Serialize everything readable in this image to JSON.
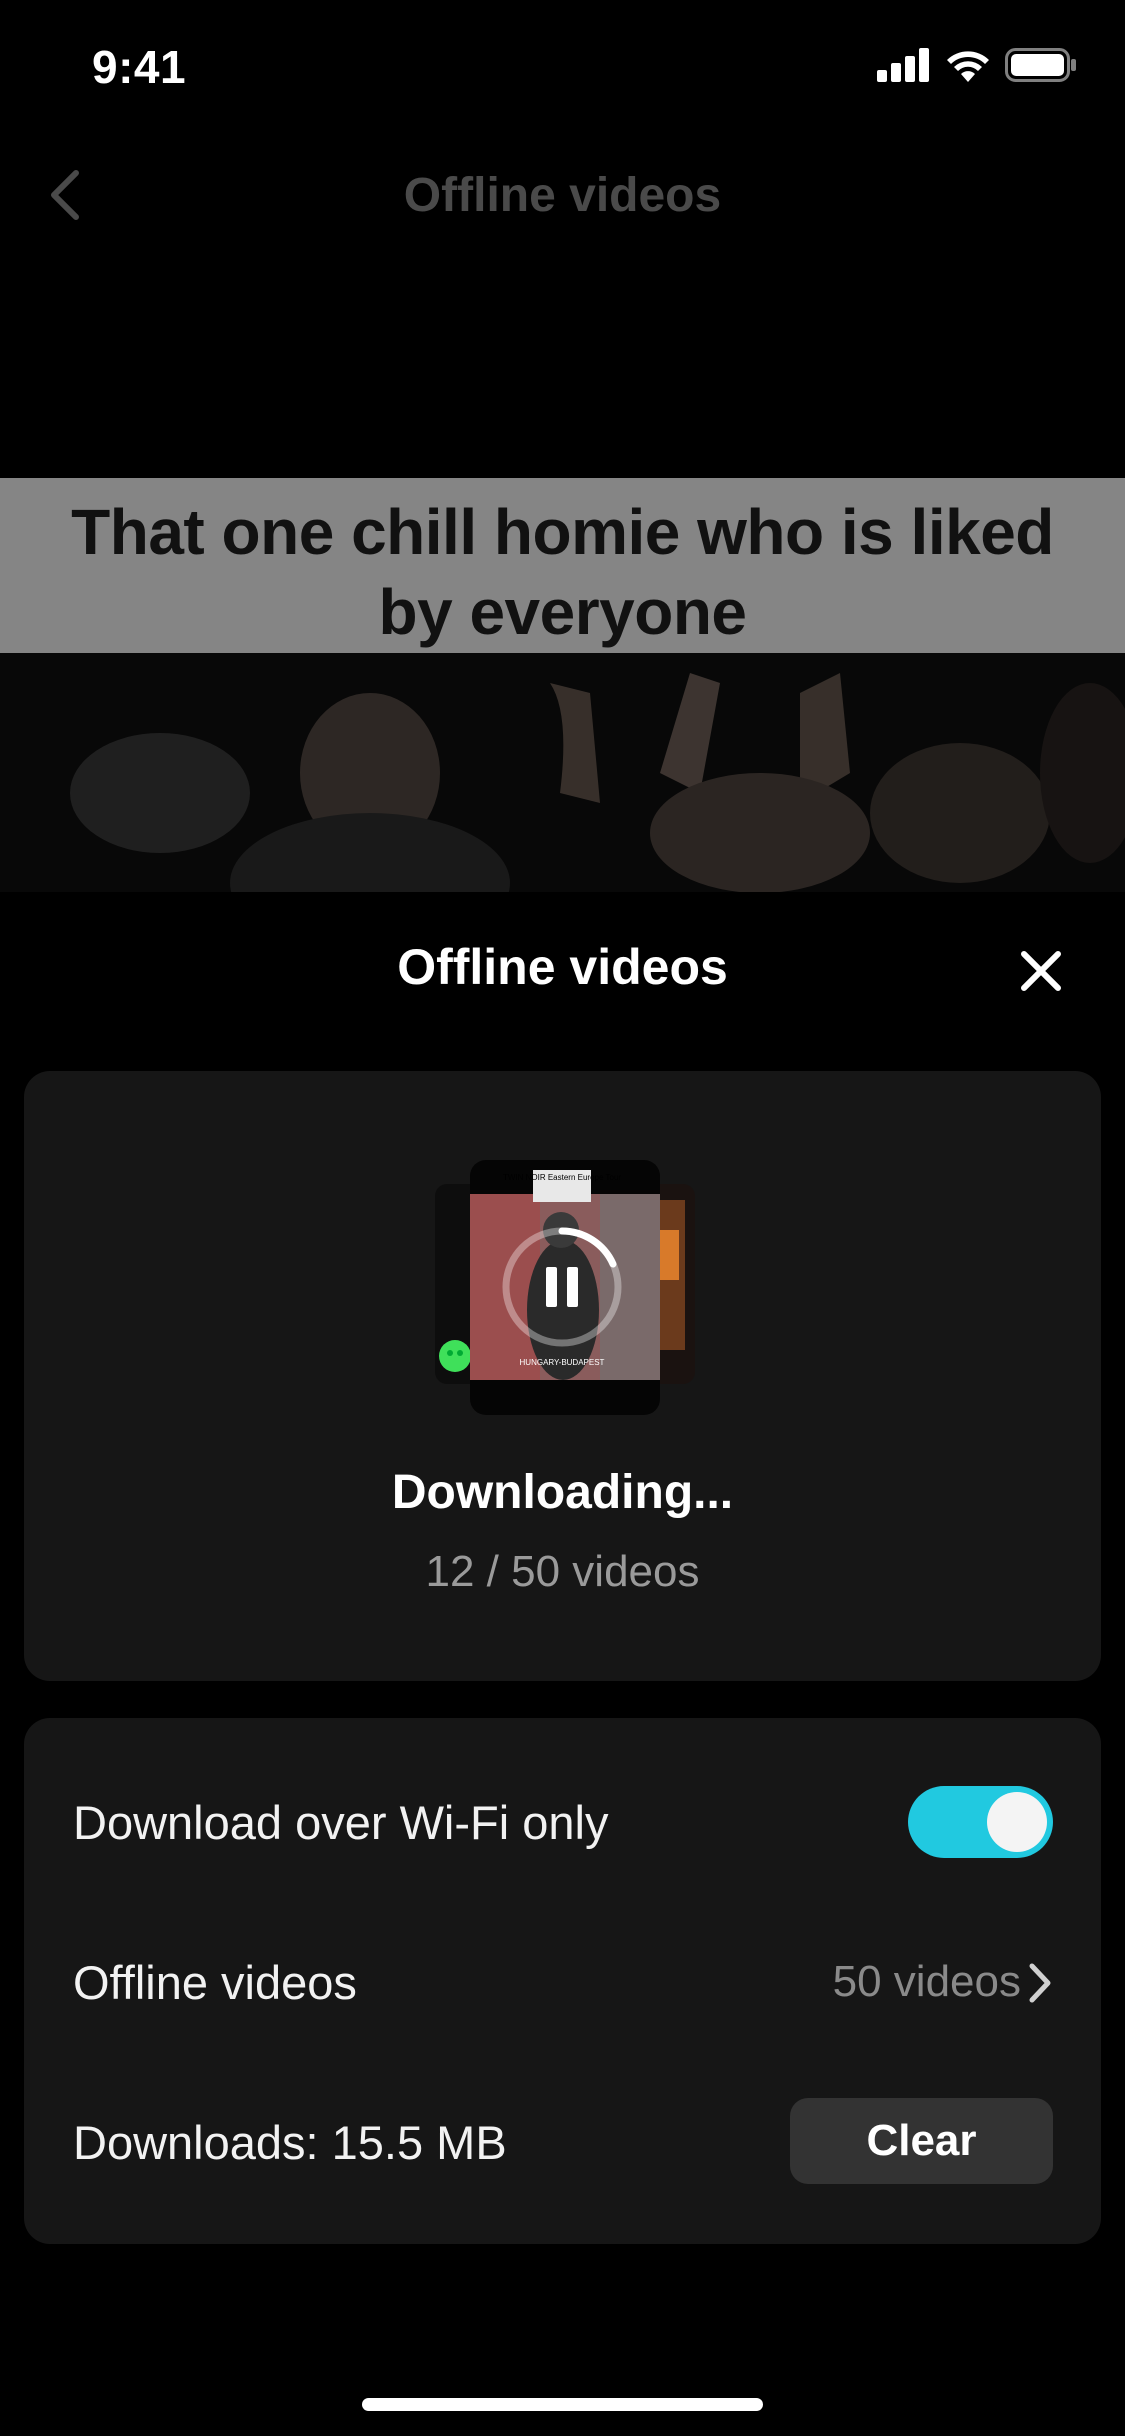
{
  "status_bar": {
    "time": "9:41"
  },
  "header": {
    "title": "Offline videos"
  },
  "video": {
    "caption": "That one chill homie who is liked by everyone"
  },
  "thumbnail": {
    "sign_text": "TWIN NOIR Eastern Europe Tour",
    "location_text": "HUNGARY-BUDAPEST"
  },
  "sheet": {
    "title": "Offline videos",
    "download": {
      "status": "Downloading...",
      "progress": "12 / 50 videos"
    },
    "settings": {
      "wifi_label": "Download over Wi-Fi only",
      "wifi_enabled": true,
      "offline_label": "Offline videos",
      "offline_value": "50 videos",
      "downloads_label": "Downloads: 15.5 MB",
      "clear_label": "Clear"
    }
  },
  "colors": {
    "accent": "#21c9e0",
    "card": "#161616",
    "button": "#333333"
  }
}
